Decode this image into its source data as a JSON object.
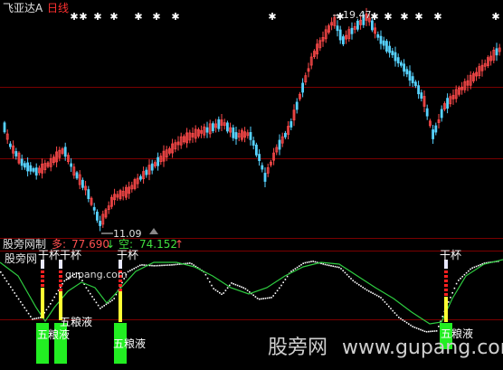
{
  "header": {
    "stock_name": "飞亚达A",
    "period": "日线",
    "stock_name_color": "#e0e0e0",
    "period_color": "#ff3030"
  },
  "price_panel": {
    "high_label": "19.47",
    "low_label": "11.09",
    "up_color": "#ff4a4a",
    "down_color": "#56d2ff"
  },
  "indicator_panel": {
    "name": "股旁网制",
    "long_label": "多:",
    "long_value": "77.690",
    "long_arrow": "↓",
    "short_label": "空:",
    "short_value": "74.152",
    "short_arrow": "↑",
    "chart_watermark": "股旁网",
    "site_overlay": "gupang.com",
    "signals": {
      "cup_single": "干杯",
      "cup_pair": "干杯干杯",
      "jade": "五粮液",
      "jade_overlap": "五粮液"
    },
    "colors": {
      "long": "#ff5050",
      "short": "#40e040",
      "fast_line": "#ffffff",
      "slow_line": "#2ecc40",
      "bar_green": "#22ee22",
      "bar_yellow": "#ffff33",
      "bar_white": "#e8e8ff",
      "bar_red": "#ff2020"
    }
  },
  "watermark": {
    "brand": "股旁网",
    "url": "www.gupang.com"
  },
  "chart_data": {
    "type": "candlestick",
    "price_high": 19.47,
    "price_low": 11.09,
    "indicator_values": {
      "long": 77.69,
      "short": 74.152
    }
  }
}
